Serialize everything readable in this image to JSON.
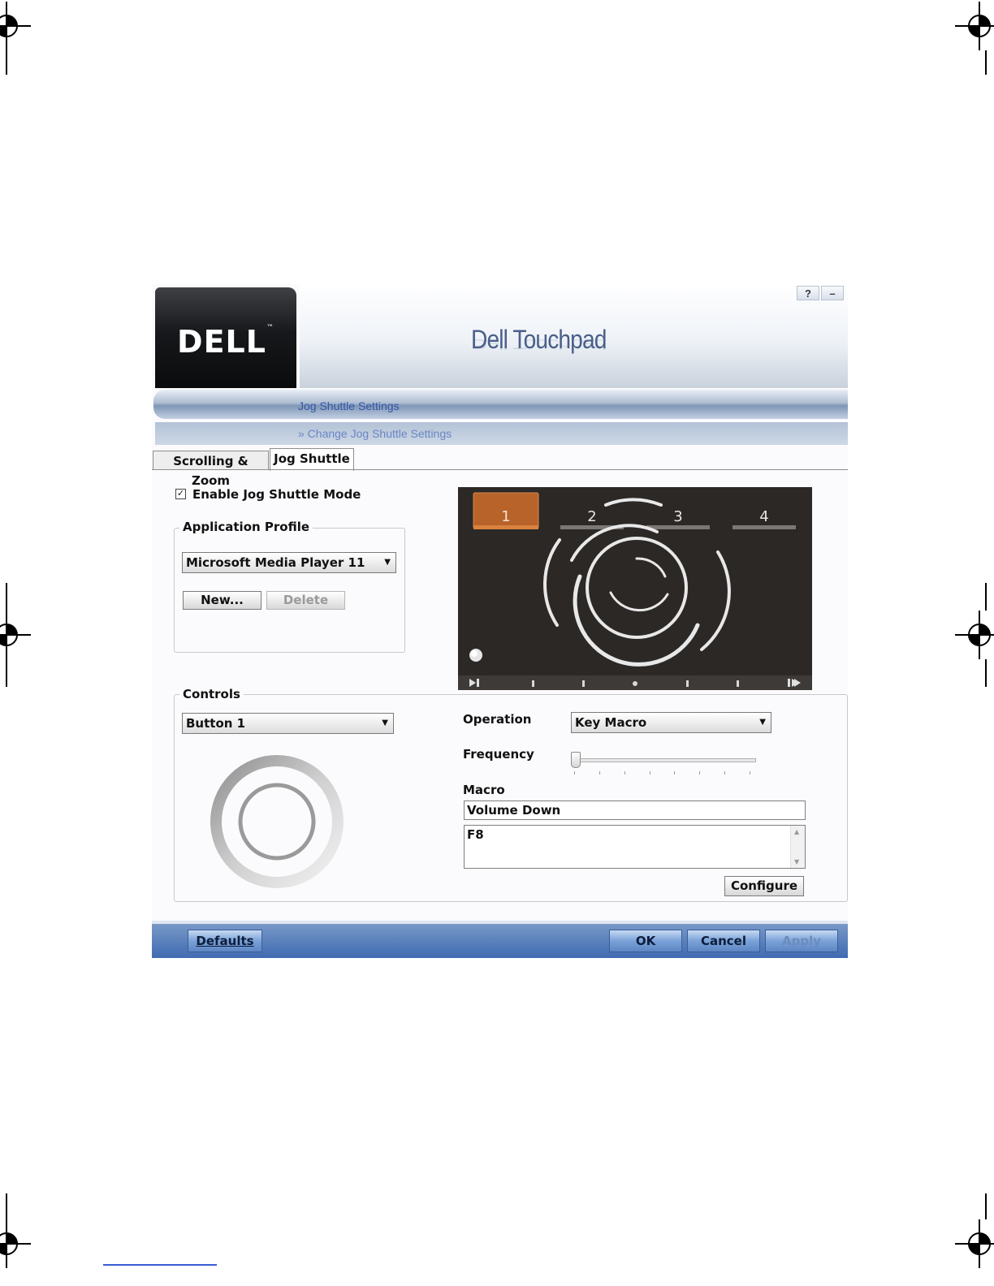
{
  "window": {
    "logo": "DELL",
    "title": "Dell Touchpad",
    "help_button": "?",
    "minimize_button": "–",
    "section_title": "Jog Shuttle Settings",
    "section_subtitle": "» Change Jog Shuttle Settings"
  },
  "tabs": [
    {
      "label": "Scrolling & Zoom",
      "active": false
    },
    {
      "label": "Jog Shuttle",
      "active": true
    }
  ],
  "jog": {
    "enable_label": "Enable Jog Shuttle Mode",
    "enabled": true,
    "profile_group_label": "Application Profile",
    "profile_selected": "Microsoft Media Player 11",
    "new_button": "New...",
    "delete_button": "Delete",
    "zones": [
      "1",
      "2",
      "3",
      "4"
    ],
    "active_zone": "1"
  },
  "controls": {
    "group_label": "Controls",
    "button_selected": "Button 1",
    "operation_label": "Operation",
    "operation_selected": "Key Macro",
    "frequency_label": "Frequency",
    "frequency_level": 0,
    "macro_label": "Macro",
    "macro_name": "Volume Down",
    "macro_keys": "F8",
    "configure_button": "Configure"
  },
  "footer": {
    "defaults_button": "Defaults",
    "ok_button": "OK",
    "cancel_button": "Cancel",
    "apply_button": "Apply"
  },
  "colors": {
    "active_zone": "#b8632a",
    "footer": "#4a74b7",
    "title": "#4a5f8a"
  }
}
